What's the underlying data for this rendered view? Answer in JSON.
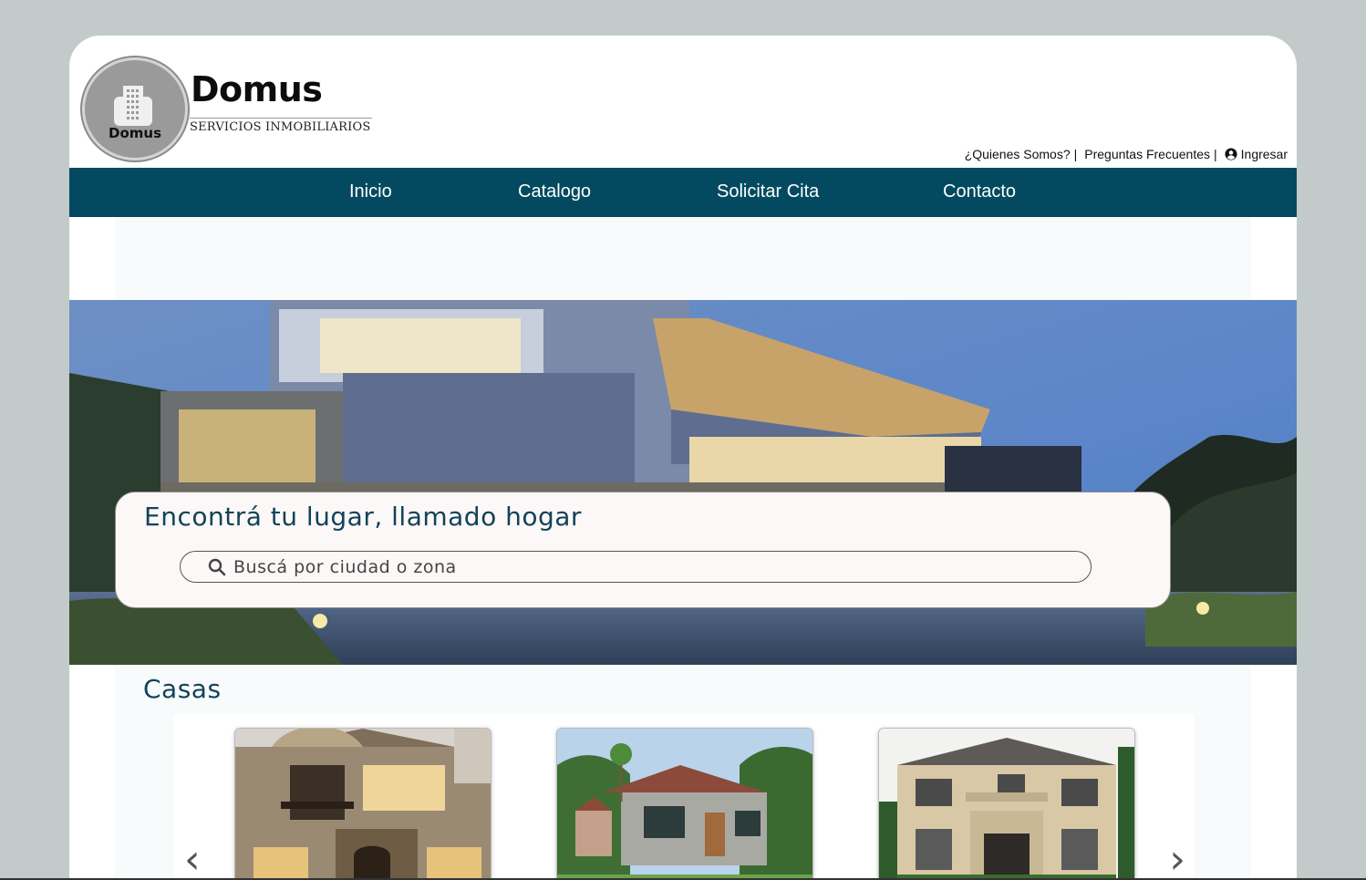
{
  "brand": {
    "logo_text": "Domus",
    "name": "Domus",
    "subtitle": "SERVICIOS INMOBILIARIOS"
  },
  "top_links": {
    "about": "¿Quienes Somos?",
    "faq": "Preguntas Frecuentes",
    "login": "Ingresar",
    "separator": "|"
  },
  "nav": {
    "items": [
      "Inicio",
      "Catalogo",
      "Solicitar Cita",
      "Contacto"
    ]
  },
  "hero": {
    "title": "Encontrá tu lugar, llamado hogar",
    "search_placeholder": "Buscá por ciudad o zona"
  },
  "section": {
    "title": "Casas",
    "prev_arrow": "‹",
    "next_arrow": "›"
  },
  "colors": {
    "nav_bg": "#034a60",
    "heading": "#12435a",
    "page_bg": "#c2cbc9"
  },
  "icons": {
    "user": "user-circle-icon",
    "search": "search-icon",
    "logo": "building-icon"
  }
}
